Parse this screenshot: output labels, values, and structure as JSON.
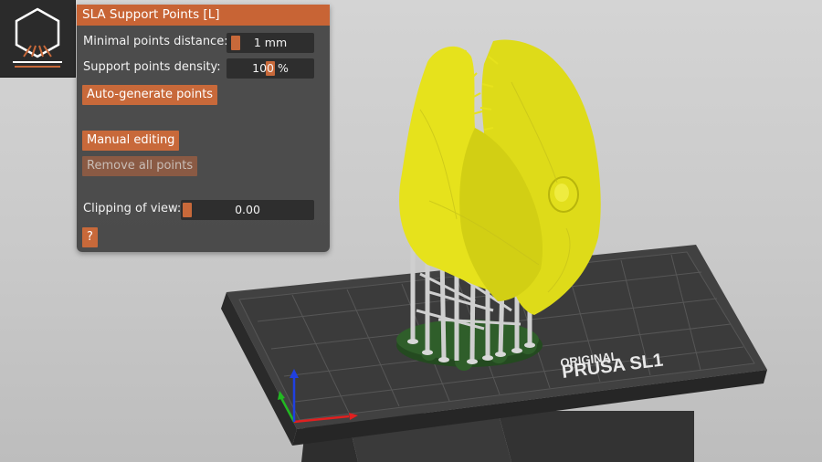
{
  "panel": {
    "title": "SLA Support Points [L]",
    "min_distance": {
      "label": "Minimal points distance:",
      "value": "1 mm",
      "fraction": 0.02
    },
    "density": {
      "label": "Support points density:",
      "value": "100 %",
      "fraction": 0.5
    },
    "auto_generate_label": "Auto-generate points",
    "manual_editing_label": "Manual editing",
    "remove_all_label": "Remove all points",
    "clipping": {
      "label": "Clipping of view:",
      "value": "0.00",
      "fraction": 0.0
    },
    "help_label": "?"
  },
  "bed": {
    "brand_line1": "ORIGINAL",
    "brand_line2": "PRUSA SL1"
  },
  "colors": {
    "accent": "#c8693a",
    "model": "#e6e21c",
    "supports": "#cfcfcf",
    "pad": "#2f5e2a",
    "bed": "#3a3a3a",
    "axis_x": "#e02020",
    "axis_y": "#22b822",
    "axis_z": "#2040e0"
  },
  "icons": {
    "tool": "sla-support-points-icon"
  }
}
